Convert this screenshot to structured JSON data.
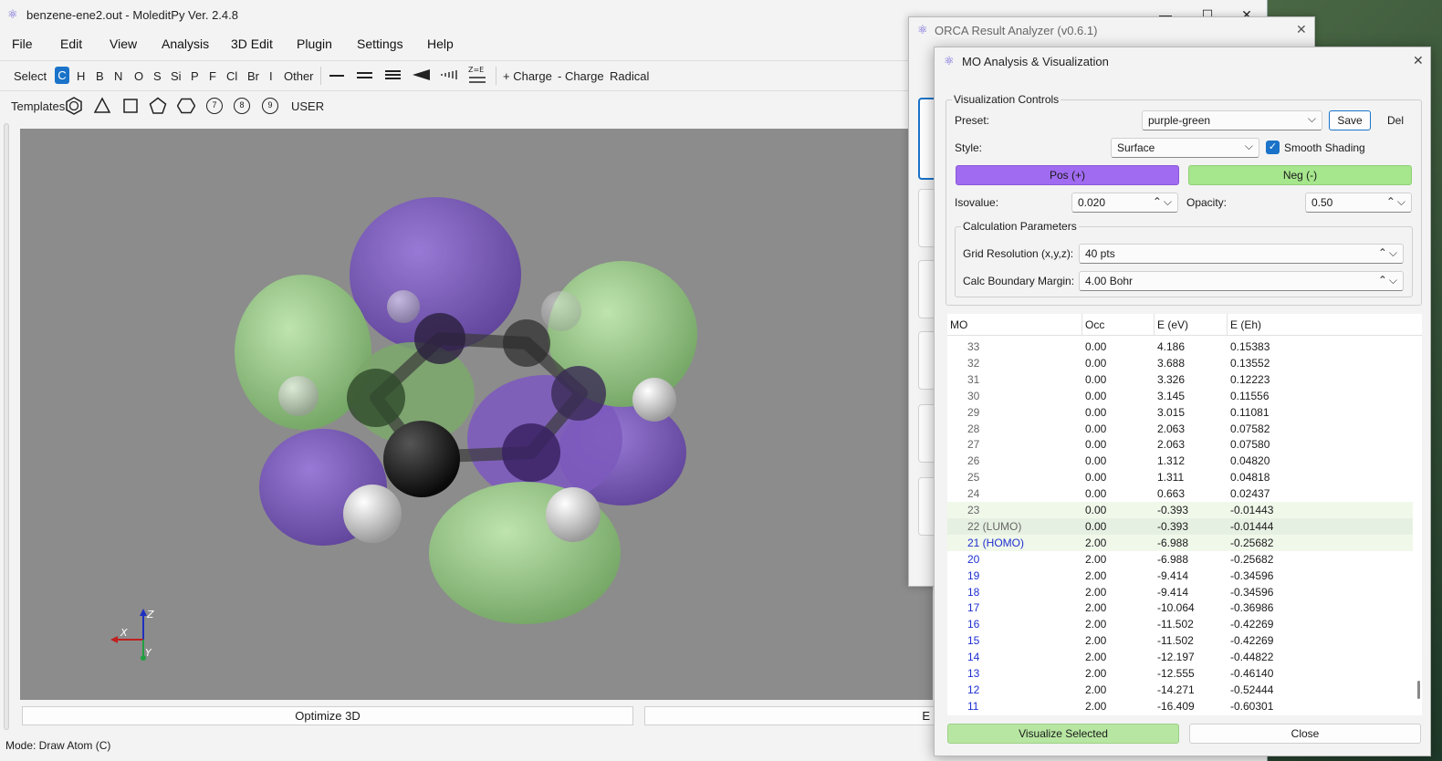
{
  "main_window": {
    "title": "benzene-ene2.out - MoleditPy Ver. 2.4.8",
    "menu": [
      "File",
      "Edit",
      "View",
      "Analysis",
      "3D Edit",
      "Plugin",
      "Settings",
      "Help"
    ],
    "toolbar": {
      "select": "Select",
      "elements": [
        "C",
        "H",
        "B",
        "N",
        "O",
        "S",
        "Si",
        "P",
        "F",
        "Cl",
        "Br",
        "I",
        "Other"
      ],
      "active_element": "C",
      "plus_charge": "+ Charge",
      "minus_charge": "- Charge",
      "radical": "Radical"
    },
    "templates": {
      "label": "Templates:",
      "ring7": "7",
      "ring8": "8",
      "ring9": "9",
      "user": "USER"
    },
    "axes": {
      "x": "X",
      "y": "Y",
      "z": "Z"
    },
    "optimize_button": "Optimize 3D",
    "export_button_partial": "E",
    "status": "Mode: Draw Atom (C)"
  },
  "orca_window": {
    "title": "ORCA Result Analyzer (v0.6.1)"
  },
  "mo_window": {
    "title": "MO Analysis & Visualization",
    "visualization_controls": {
      "group_title": "Visualization Controls",
      "preset_label": "Preset:",
      "preset_value": "purple-green",
      "save": "Save",
      "del": "Del",
      "style_label": "Style:",
      "style_value": "Surface",
      "smooth_shading": "Smooth Shading",
      "pos_button": "Pos (+)",
      "neg_button": "Neg (-)",
      "pos_color": "#a06bf0",
      "neg_color": "#a6e68c",
      "isovalue_label": "Isovalue:",
      "isovalue": "0.020",
      "opacity_label": "Opacity:",
      "opacity": "0.50"
    },
    "calc_params": {
      "group_title": "Calculation Parameters",
      "grid_label": "Grid Resolution (x,y,z):",
      "grid_value": "40 pts",
      "margin_label": "Calc Boundary Margin:",
      "margin_value": "4.00 Bohr"
    },
    "table": {
      "headers": [
        "MO",
        "Occ",
        "E (eV)",
        "E (Eh)"
      ],
      "rows": [
        {
          "mo": "33",
          "occ": "0.00",
          "ev": "4.186",
          "eh": "0.15383"
        },
        {
          "mo": "32",
          "occ": "0.00",
          "ev": "3.688",
          "eh": "0.13552"
        },
        {
          "mo": "31",
          "occ": "0.00",
          "ev": "3.326",
          "eh": "0.12223"
        },
        {
          "mo": "30",
          "occ": "0.00",
          "ev": "3.145",
          "eh": "0.11556"
        },
        {
          "mo": "29",
          "occ": "0.00",
          "ev": "3.015",
          "eh": "0.11081"
        },
        {
          "mo": "28",
          "occ": "0.00",
          "ev": "2.063",
          "eh": "0.07582"
        },
        {
          "mo": "27",
          "occ": "0.00",
          "ev": "2.063",
          "eh": "0.07580"
        },
        {
          "mo": "26",
          "occ": "0.00",
          "ev": "1.312",
          "eh": "0.04820"
        },
        {
          "mo": "25",
          "occ": "0.00",
          "ev": "1.311",
          "eh": "0.04818"
        },
        {
          "mo": "24",
          "occ": "0.00",
          "ev": "0.663",
          "eh": "0.02437"
        },
        {
          "mo": "23",
          "occ": "0.00",
          "ev": "-0.393",
          "eh": "-0.01443"
        },
        {
          "mo": "22 (LUMO)",
          "occ": "0.00",
          "ev": "-0.393",
          "eh": "-0.01444"
        },
        {
          "mo": "21 (HOMO)",
          "occ": "2.00",
          "ev": "-6.988",
          "eh": "-0.25682"
        },
        {
          "mo": "20",
          "occ": "2.00",
          "ev": "-6.988",
          "eh": "-0.25682"
        },
        {
          "mo": "19",
          "occ": "2.00",
          "ev": "-9.414",
          "eh": "-0.34596"
        },
        {
          "mo": "18",
          "occ": "2.00",
          "ev": "-9.414",
          "eh": "-0.34596"
        },
        {
          "mo": "17",
          "occ": "2.00",
          "ev": "-10.064",
          "eh": "-0.36986"
        },
        {
          "mo": "16",
          "occ": "2.00",
          "ev": "-11.502",
          "eh": "-0.42269"
        },
        {
          "mo": "15",
          "occ": "2.00",
          "ev": "-11.502",
          "eh": "-0.42269"
        },
        {
          "mo": "14",
          "occ": "2.00",
          "ev": "-12.197",
          "eh": "-0.44822"
        },
        {
          "mo": "13",
          "occ": "2.00",
          "ev": "-12.555",
          "eh": "-0.46140"
        },
        {
          "mo": "12",
          "occ": "2.00",
          "ev": "-14.271",
          "eh": "-0.52444"
        },
        {
          "mo": "11",
          "occ": "2.00",
          "ev": "-16.409",
          "eh": "-0.60301"
        }
      ]
    },
    "visualize_button": "Visualize Selected",
    "close_button": "Close"
  }
}
